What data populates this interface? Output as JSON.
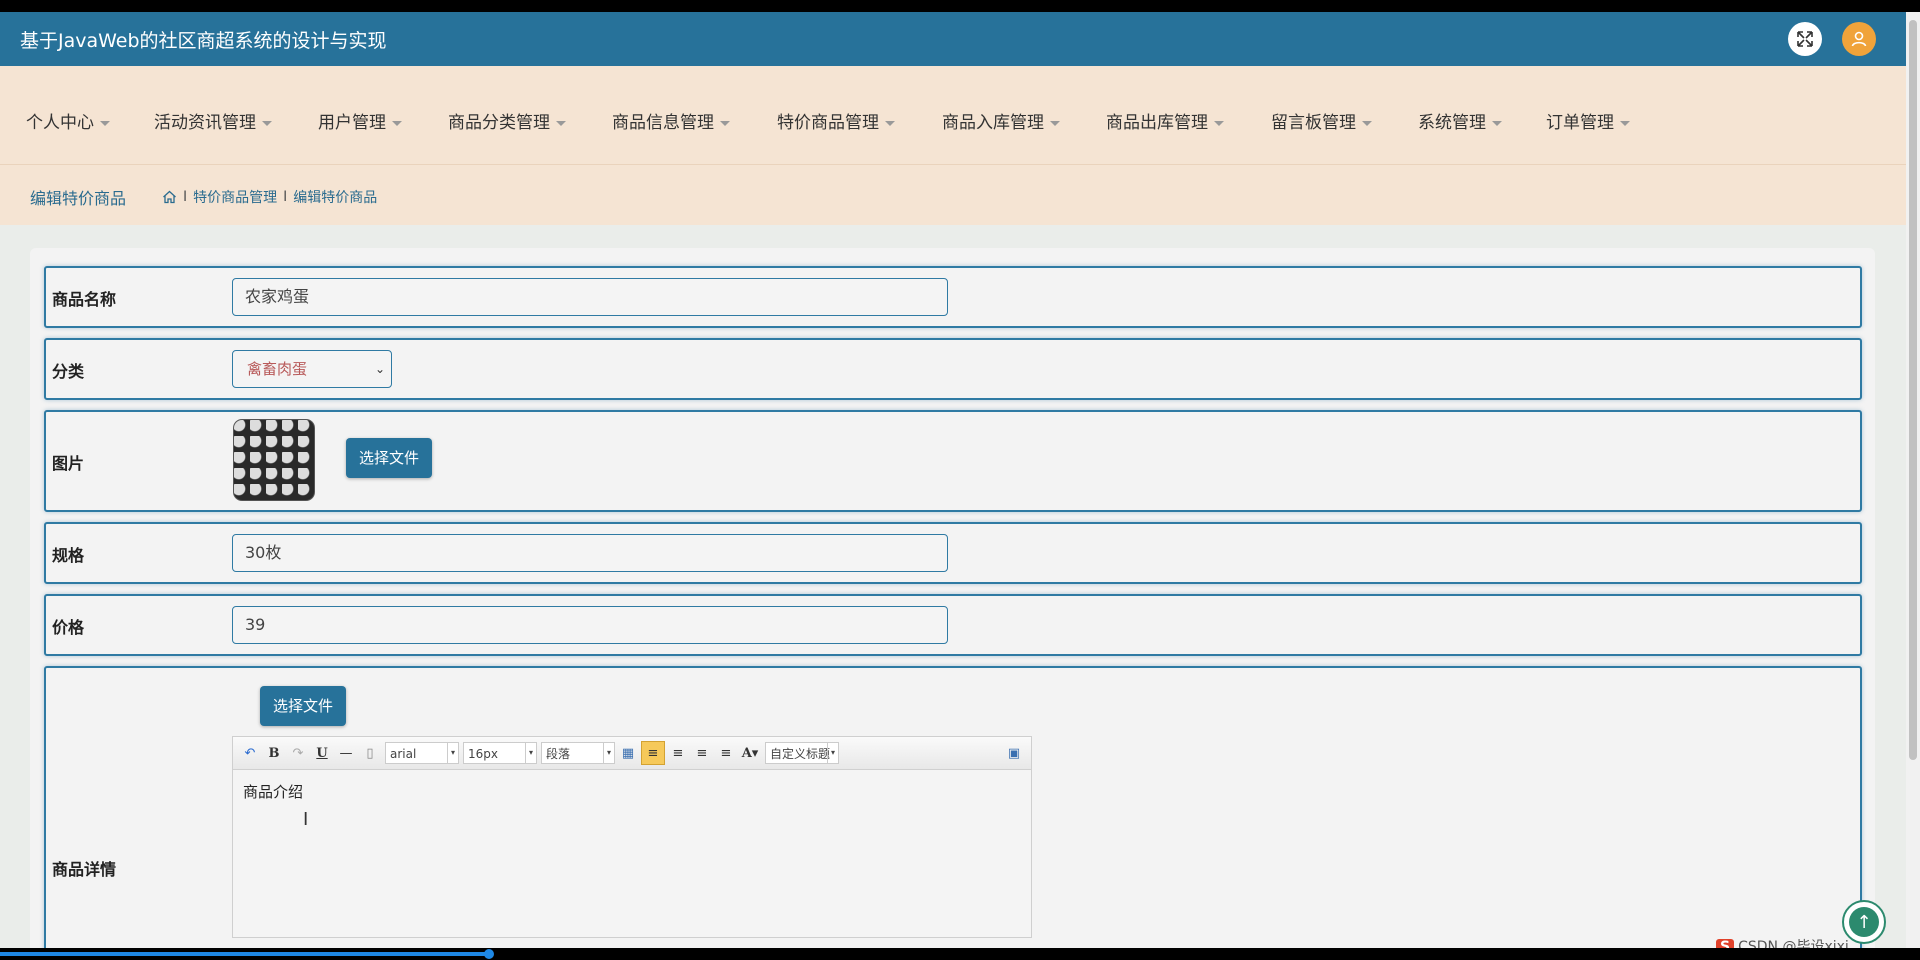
{
  "header": {
    "title": "基于JavaWeb的社区商超系统的设计与实现"
  },
  "nav": {
    "items": [
      {
        "label": "个人中心"
      },
      {
        "label": "活动资讯管理"
      },
      {
        "label": "用户管理"
      },
      {
        "label": "商品分类管理"
      },
      {
        "label": "商品信息管理"
      },
      {
        "label": "特价商品管理"
      },
      {
        "label": "商品入库管理"
      },
      {
        "label": "商品出库管理"
      },
      {
        "label": "留言板管理"
      },
      {
        "label": "系统管理"
      },
      {
        "label": "订单管理"
      }
    ]
  },
  "breadcrumb": {
    "page_title": "编辑特价商品",
    "separator": "I",
    "items": [
      "特价商品管理",
      "编辑特价商品"
    ]
  },
  "form": {
    "name_label": "商品名称",
    "name_value": "农家鸡蛋",
    "category_label": "分类",
    "category_value": "禽畜肉蛋",
    "image_label": "图片",
    "choose_file": "选择文件",
    "spec_label": "规格",
    "spec_value": "30枚",
    "price_label": "价格",
    "price_value": "39",
    "detail_label": "商品详情",
    "detail_choose_file": "选择文件"
  },
  "editor": {
    "font_family": "arial",
    "font_size": "16px",
    "paragraph": "段落",
    "custom_title": "自定义标题",
    "content": "商品介绍"
  },
  "watermark": {
    "text": "CSDN @毕设xixi"
  },
  "colors": {
    "primary": "#27729a",
    "nav_bg": "#f5e4d3",
    "accent": "#f0a33a"
  }
}
